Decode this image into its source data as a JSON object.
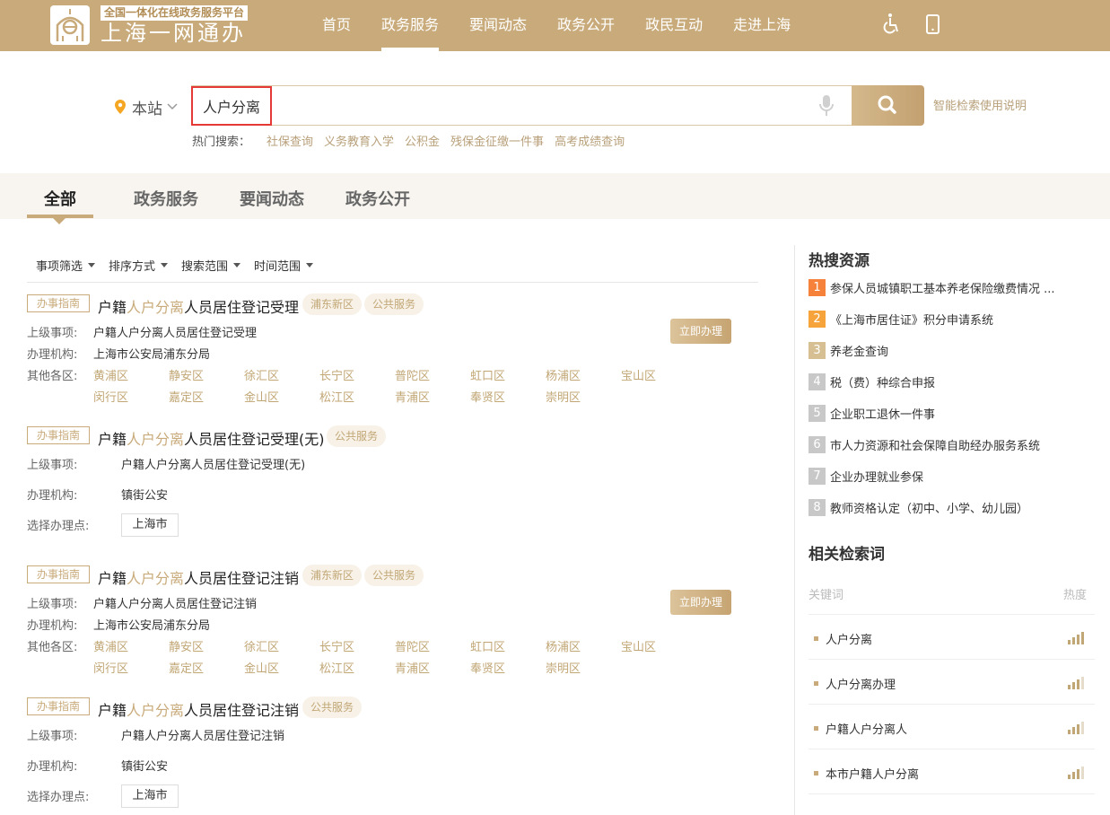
{
  "header": {
    "logo_sub": "全国一体化在线政务服务平台",
    "logo_main": "上海一网通办",
    "nav": [
      "首页",
      "政务服务",
      "要闻动态",
      "政务公开",
      "政民互动",
      "走进上海"
    ],
    "nav_active": 1,
    "accessibility_icon": "wheelchair-icon",
    "mobile_icon": "mobile-phone-icon"
  },
  "search": {
    "site": "本站",
    "query": "人户分离",
    "help": "智能检索使用说明",
    "hot_label": "热门搜索：",
    "hot_links": [
      "社保查询",
      "义务教育入学",
      "公积金",
      "残保金征缴一件事",
      "高考成绩查询"
    ]
  },
  "tabs": [
    "全部",
    "政务服务",
    "要闻动态",
    "政务公开"
  ],
  "tab_active": 0,
  "filters": [
    "事项筛选",
    "排序方式",
    "搜索范围",
    "时间范围"
  ],
  "results": [
    {
      "tag": "办事指南",
      "title_pre": "户籍",
      "title_hl": "人户分离",
      "title_post": "人员居住登记受理",
      "chips": [
        "浦东新区",
        "公共服务"
      ],
      "parent_label": "上级事项:",
      "parent": "户籍人户分离人员居住登记受理",
      "org_label": "办理机构:",
      "org": "上海市公安局浦东分局",
      "other_label": "其他各区:",
      "districts": [
        "黄浦区",
        "静安区",
        "徐汇区",
        "长宁区",
        "普陀区",
        "虹口区",
        "杨浦区",
        "宝山区",
        "闵行区",
        "嘉定区",
        "金山区",
        "松江区",
        "青浦区",
        "奉贤区",
        "崇明区"
      ],
      "button": "立即办理"
    },
    {
      "tag": "办事指南",
      "title_pre": "户籍",
      "title_hl": "人户分离",
      "title_post": "人员居住登记受理(无)",
      "chips": [
        "公共服务"
      ],
      "parent_label": "上级事项:",
      "parent": "户籍人户分离人员居住登记受理(无)",
      "org_label": "办理机构:",
      "org": "镇街公安",
      "loc_label": "选择办理点:",
      "loc": "上海市"
    },
    {
      "tag": "办事指南",
      "title_pre": "户籍",
      "title_hl": "人户分离",
      "title_post": "人员居住登记注销",
      "chips": [
        "浦东新区",
        "公共服务"
      ],
      "parent_label": "上级事项:",
      "parent": "户籍人户分离人员居住登记注销",
      "org_label": "办理机构:",
      "org": "上海市公安局浦东分局",
      "other_label": "其他各区:",
      "districts": [
        "黄浦区",
        "静安区",
        "徐汇区",
        "长宁区",
        "普陀区",
        "虹口区",
        "杨浦区",
        "宝山区",
        "闵行区",
        "嘉定区",
        "金山区",
        "松江区",
        "青浦区",
        "奉贤区",
        "崇明区"
      ],
      "button": "立即办理"
    },
    {
      "tag": "办事指南",
      "title_pre": "户籍",
      "title_hl": "人户分离",
      "title_post": "人员居住登记注销",
      "chips": [
        "公共服务"
      ],
      "parent_label": "上级事项:",
      "parent": "户籍人户分离人员居住登记注销",
      "org_label": "办理机构:",
      "org": "镇街公安",
      "loc_label": "选择办理点:",
      "loc": "上海市"
    }
  ],
  "hot_resources": {
    "title": "热搜资源",
    "items": [
      {
        "rank": "1",
        "text": "参保人员城镇职工基本养老保险缴费情况 ...",
        "color": "#f5813a"
      },
      {
        "rank": "2",
        "text": "《上海市居住证》积分申请系统",
        "color": "#f5a33a"
      },
      {
        "rank": "3",
        "text": "养老金查询",
        "color": "#d6bf92"
      },
      {
        "rank": "4",
        "text": "税（费）种综合申报",
        "color": "#c8c8c8"
      },
      {
        "rank": "5",
        "text": "企业职工退休一件事",
        "color": "#c8c8c8"
      },
      {
        "rank": "6",
        "text": "市人力资源和社会保障自助经办服务系统",
        "color": "#c8c8c8"
      },
      {
        "rank": "7",
        "text": "企业办理就业参保",
        "color": "#c8c8c8"
      },
      {
        "rank": "8",
        "text": "教师资格认定（初中、小学、幼儿园）",
        "color": "#c8c8c8"
      }
    ]
  },
  "related": {
    "title": "相关检索词",
    "col_keyword": "关键词",
    "col_heat": "热度",
    "items": [
      {
        "text": "人户分离",
        "heat": 4
      },
      {
        "text": "人户分离办理",
        "heat": 3
      },
      {
        "text": "户籍人户分离人",
        "heat": 3
      },
      {
        "text": "本市户籍人户分离",
        "heat": 3
      }
    ]
  }
}
